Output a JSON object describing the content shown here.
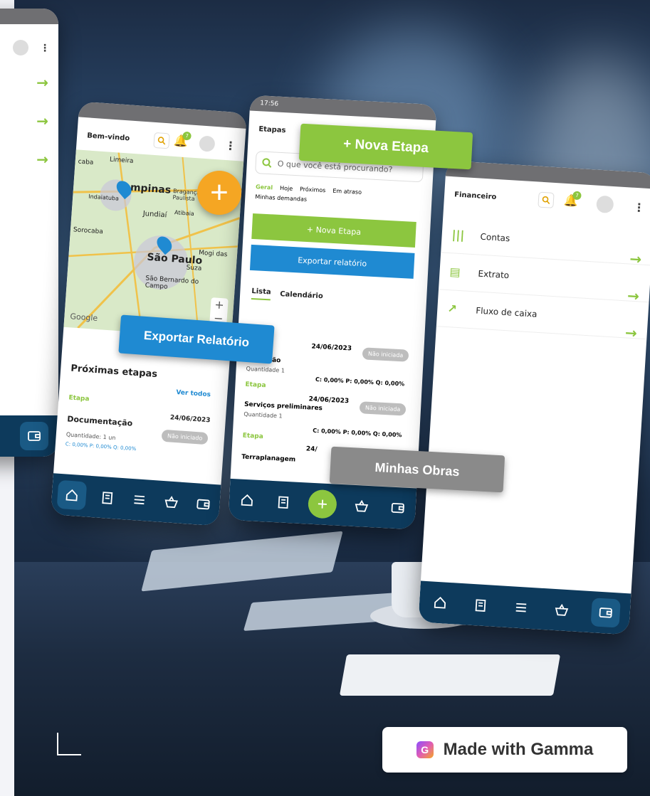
{
  "phone_left_edge": {
    "arrows": [
      "→",
      "→",
      "→"
    ]
  },
  "phone_map": {
    "title": "Bem-vindo",
    "notification_count": "7",
    "map_labels": [
      "Limeira",
      "caba",
      "Campinas",
      "Bragança Paulista",
      "Indaiatuba",
      "Jundiaí",
      "Atibaia",
      "Sorocaba",
      "São Paulo",
      "Mogi das",
      "Suza",
      "São Bernardo do Campo",
      "Google"
    ],
    "section_title": "Próximas etapas",
    "see_all": "Ver todos",
    "stage_label": "Etapa",
    "item": {
      "name": "Documentação",
      "date": "24/06/2023",
      "status": "Não iniciado",
      "quantity": "Quantidade: 1 un",
      "stats": "C: 0,00%   P: 0,00%   Q: 0,00%"
    }
  },
  "phone_etapas": {
    "time": "17:56",
    "title": "Etapas",
    "search_placeholder": "O que você está procurando?",
    "filters": [
      "Geral",
      "Hoje",
      "Próximos",
      "Em atraso",
      "Minhas demandas"
    ],
    "new_button": "+ Nova Etapa",
    "export_button": "Exportar relatório",
    "tabs": [
      "Lista",
      "Calendário"
    ],
    "rows": [
      {
        "stage": "",
        "name": "Documentação",
        "quantity": "Quantidade 1",
        "date": "24/06/2023",
        "status": "Não iniciada",
        "stats": "C: 0,00%  P: 0,00%  Q: 0,00%"
      },
      {
        "stage": "Etapa",
        "name": "Serviços preliminares",
        "quantity": "Quantidade 1",
        "date": "24/06/2023",
        "status": "Não iniciada",
        "stats": "C: 0,00%  P: 0,00%  Q: 0,00%"
      },
      {
        "stage": "Etapa",
        "name": "Terraplanagem",
        "quantity": "",
        "date": "24/",
        "status": "",
        "stats": ""
      }
    ]
  },
  "phone_fin": {
    "title": "Financeiro",
    "notification_count": "7",
    "rows": [
      "Contas",
      "Extrato",
      "Fluxo de caixa"
    ]
  },
  "callouts": {
    "nova_etapa": "+ Nova Etapa",
    "exportar": "Exportar Relatório",
    "minhas_obras": "Minhas Obras"
  },
  "watermark": {
    "label": "Made with Gamma"
  },
  "colors": {
    "brand_green": "#8cc63f",
    "brand_blue": "#1f8ad2",
    "nav_navy": "#0d3a5c",
    "status_gray": "#bdbdbd",
    "callout_gray": "#8a8a8a"
  }
}
